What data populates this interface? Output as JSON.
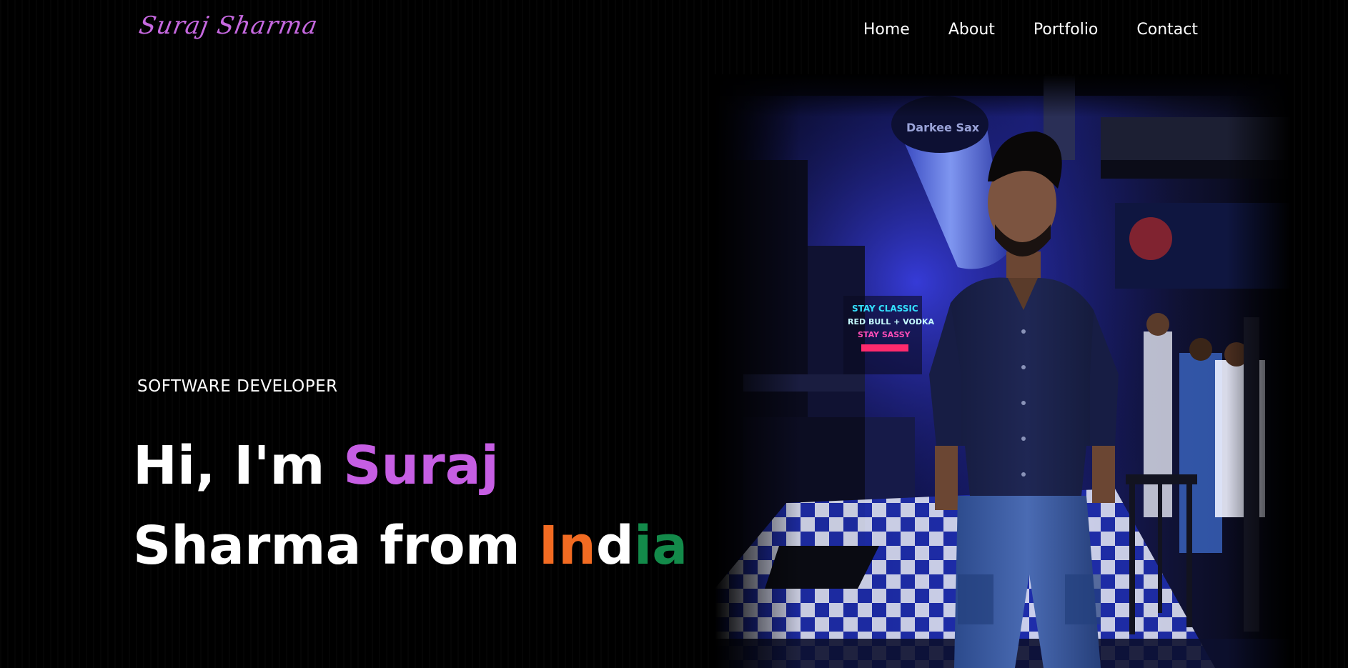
{
  "header": {
    "logo_text": "Suraj Sharma",
    "nav": [
      "Home",
      "About",
      "Portfolio",
      "Contact"
    ]
  },
  "hero": {
    "role": "SOFTWARE DEVELOPER",
    "line1_prefix": "Hi, I'm ",
    "line1_name": "Suraj",
    "line2_prefix": "Sharma from ",
    "country": [
      "In",
      "d",
      "ia"
    ]
  },
  "photo": {
    "sign_lines": [
      "STAY CLASSIC",
      "RED BULL + VODKA",
      "STAY SASSY"
    ],
    "duct_label": "Darkee Sax"
  },
  "colors": {
    "accent": "#c65ee3",
    "india_orange": "#f26b22",
    "india_white": "#ffffff",
    "india_green": "#138a4a",
    "background": "#000000"
  }
}
